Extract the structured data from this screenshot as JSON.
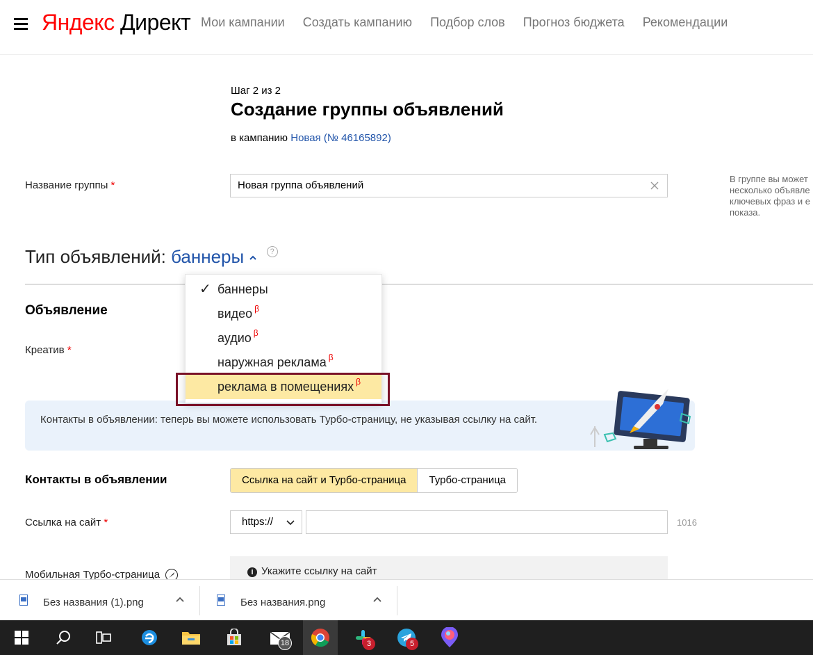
{
  "header": {
    "logo_yandex": "Яндекс",
    "logo_direct": "Директ",
    "nav": [
      "Мои кампании",
      "Создать кампанию",
      "Подбор слов",
      "Прогноз бюджета",
      "Рекомендации"
    ]
  },
  "page": {
    "step": "Шаг 2 из 2",
    "title": "Создание группы объявлений",
    "campaign_prefix": "в кампанию",
    "campaign_link": "Новая (№ 46165892)"
  },
  "group": {
    "label": "Название группы",
    "required": "*",
    "value": "Новая группа объявлений",
    "side_note": [
      "В группе вы может",
      "несколько объявле",
      "ключевых фраз и е",
      "показа."
    ]
  },
  "ad_type": {
    "label": "Тип объявлений:",
    "value": "баннеры",
    "help": "?",
    "options": [
      {
        "label": "баннеры",
        "checked": true,
        "beta": ""
      },
      {
        "label": "видео",
        "checked": false,
        "beta": "β"
      },
      {
        "label": "аудио",
        "checked": false,
        "beta": "β"
      },
      {
        "label": "наружная реклама",
        "checked": false,
        "beta": "β"
      },
      {
        "label": "реклама в помещениях",
        "checked": false,
        "beta": "β"
      }
    ],
    "check_glyph": "✓"
  },
  "ad": {
    "section": "Объявление",
    "creative_label": "Креатив",
    "required": "*"
  },
  "banner": {
    "text": "Контакты в объявлении: теперь вы можете использовать Турбо-страницу, не указывая ссылку на сайт."
  },
  "contacts": {
    "section": "Контакты в объявлении",
    "options": [
      "Ссылка на сайт и Турбо-страница",
      "Турбо-страница"
    ],
    "selected": 0
  },
  "site": {
    "label": "Ссылка на сайт",
    "required": "*",
    "protocol": "https://",
    "value": "",
    "counter": "1016"
  },
  "turbo": {
    "label": "Мобильная Турбо-страница",
    "hint": "Укажите ссылку на сайт"
  },
  "downloads": [
    {
      "name": "Без названия (1).png"
    },
    {
      "name": "Без названия.png"
    }
  ],
  "taskbar": {
    "mail_badge": "18",
    "slack_badge": "3",
    "telegram_badge": "5"
  },
  "colors": {
    "accent_link": "#2255aa",
    "highlight": "#fde9a3",
    "required": "#e00000",
    "outline": "#7a1228"
  }
}
